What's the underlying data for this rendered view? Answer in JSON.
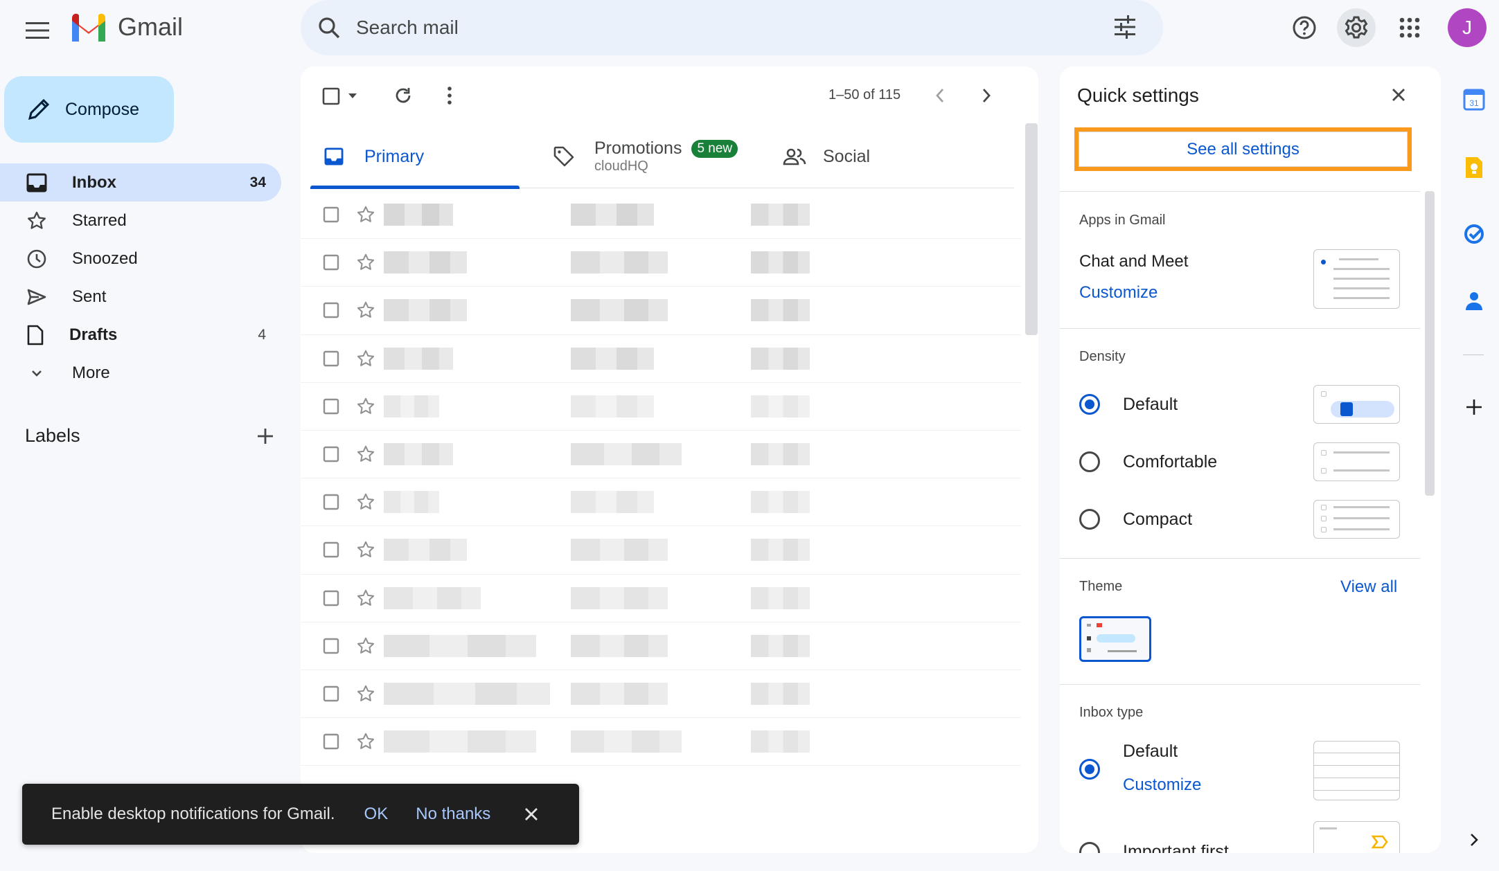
{
  "app": {
    "name": "Gmail"
  },
  "search": {
    "placeholder": "Search mail"
  },
  "user": {
    "initial": "J",
    "avatar_color": "#b146c2"
  },
  "compose": {
    "label": "Compose"
  },
  "nav": {
    "items": [
      {
        "label": "Inbox",
        "count": "34",
        "icon": "inbox-icon",
        "active": true
      },
      {
        "label": "Starred",
        "count": "",
        "icon": "star-icon"
      },
      {
        "label": "Snoozed",
        "count": "",
        "icon": "clock-icon"
      },
      {
        "label": "Sent",
        "count": "",
        "icon": "send-icon"
      },
      {
        "label": "Drafts",
        "count": "4",
        "icon": "draft-icon"
      },
      {
        "label": "More",
        "count": "",
        "icon": "chevron-down-icon"
      }
    ]
  },
  "labels": {
    "title": "Labels"
  },
  "toolbar": {
    "pagination": "1–50 of 115"
  },
  "tabs": [
    {
      "label": "Primary",
      "icon": "inbox-icon"
    },
    {
      "label": "Promotions",
      "badge": "5 new",
      "sub": "cloudHQ",
      "icon": "tag-icon",
      "badge_color": "#188038"
    },
    {
      "label": "Social",
      "icon": "people-icon"
    }
  ],
  "quick_settings": {
    "title": "Quick settings",
    "see_all": "See all settings",
    "highlight_color": "#fa9a1c",
    "apps": {
      "heading": "Apps in Gmail",
      "item": "Chat and Meet",
      "link": "Customize"
    },
    "density": {
      "heading": "Density",
      "options": [
        {
          "label": "Default",
          "selected": true
        },
        {
          "label": "Comfortable",
          "selected": false
        },
        {
          "label": "Compact",
          "selected": false
        }
      ]
    },
    "theme": {
      "heading": "Theme",
      "link": "View all"
    },
    "inbox_type": {
      "heading": "Inbox type",
      "options": [
        {
          "label": "Default",
          "selected": true,
          "link": "Customize"
        },
        {
          "label": "Important first",
          "selected": false
        }
      ]
    }
  },
  "snackbar": {
    "text": "Enable desktop notifications for Gmail.",
    "ok": "OK",
    "no": "No thanks"
  },
  "colors": {
    "accent": "#0b57d0",
    "nav_active": "#d3e3fd",
    "compose": "#c2e7ff",
    "background": "#f6f8fc"
  }
}
